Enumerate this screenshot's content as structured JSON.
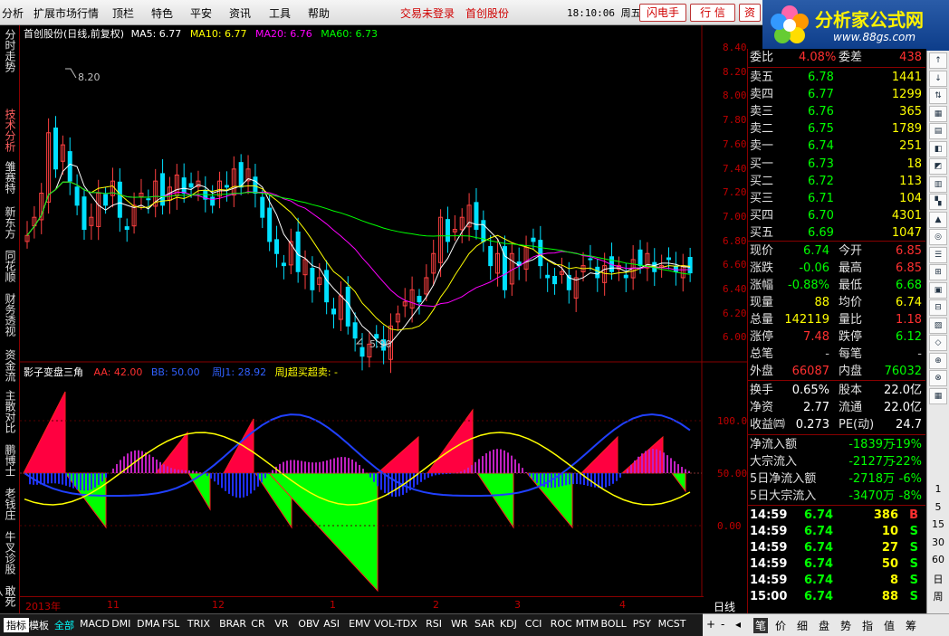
{
  "menu": [
    "分析",
    "扩展市场行情",
    "顶栏",
    "特色",
    "平安",
    "资讯",
    "工具",
    "帮助"
  ],
  "menu_status": [
    "交易未登录",
    "首创股份"
  ],
  "clock": "18:10:06 周五",
  "toolbar_buttons": [
    "闪电手",
    "行 信",
    "资"
  ],
  "logo": {
    "title": "分析家公式网",
    "url": "www.88gs.com"
  },
  "left_tabs": [
    "分时走势",
    "技术分析",
    "雏赛特",
    "新东方",
    "同花顺",
    "财务透视",
    "资金流",
    "主散对比",
    "鹏博士",
    "老钱庄",
    "牛叉诊股",
    "敢死队"
  ],
  "chart": {
    "title": "首创股份(日线,前复权)",
    "ma": [
      {
        "label": "MA5: 6.77",
        "color": "#ffffff"
      },
      {
        "label": "MA10: 6.77",
        "color": "#ffff00"
      },
      {
        "label": "MA20: 6.76",
        "color": "#ff00ff"
      },
      {
        "label": "MA60: 6.73",
        "color": "#00ff00"
      }
    ],
    "high_label": "8.20",
    "low_label": "5.90",
    "yticks": [
      "8.40",
      "8.20",
      "8.00",
      "7.80",
      "7.60",
      "7.40",
      "7.20",
      "7.00",
      "6.80",
      "6.60",
      "6.40",
      "6.20",
      "6.00"
    ]
  },
  "indicator": {
    "name": "影子变盘三角",
    "aa": "AA: 42.00",
    "bb": "BB: 50.00",
    "j": "周J1: 28.92",
    "signal": "周J超买超卖: -",
    "yticks": [
      "100.0",
      "50.00",
      "0.00"
    ]
  },
  "date_axis": [
    "2013年",
    "11",
    "12",
    "1",
    "2",
    "3",
    "4"
  ],
  "period": "日线",
  "quote": {
    "webi": {
      "label": "委比",
      "value": "4.08%",
      "label2": "委差",
      "value2": "438"
    },
    "sell": [
      {
        "label": "卖五",
        "price": "6.78",
        "vol": "1441"
      },
      {
        "label": "卖四",
        "price": "6.77",
        "vol": "1299"
      },
      {
        "label": "卖三",
        "price": "6.76",
        "vol": "365"
      },
      {
        "label": "卖二",
        "price": "6.75",
        "vol": "1789"
      },
      {
        "label": "卖一",
        "price": "6.74",
        "vol": "251"
      }
    ],
    "buy": [
      {
        "label": "买一",
        "price": "6.73",
        "vol": "18"
      },
      {
        "label": "买二",
        "price": "6.72",
        "vol": "113"
      },
      {
        "label": "买三",
        "price": "6.71",
        "vol": "104"
      },
      {
        "label": "买四",
        "price": "6.70",
        "vol": "4301"
      },
      {
        "label": "买五",
        "price": "6.69",
        "vol": "1047"
      }
    ],
    "stats": [
      {
        "l1": "现价",
        "v1": "6.74",
        "c1": "#00ff00",
        "l2": "今开",
        "v2": "6.85",
        "c2": "#ff3030"
      },
      {
        "l1": "涨跌",
        "v1": "-0.06",
        "c1": "#00ff00",
        "l2": "最高",
        "v2": "6.85",
        "c2": "#ff3030"
      },
      {
        "l1": "涨幅",
        "v1": "-0.88%",
        "c1": "#00ff00",
        "l2": "最低",
        "v2": "6.68",
        "c2": "#00ff00"
      },
      {
        "l1": "现量",
        "v1": "88",
        "c1": "#ffff00",
        "l2": "均价",
        "v2": "6.74",
        "c2": "#ffff00"
      },
      {
        "l1": "总量",
        "v1": "142119",
        "c1": "#ffff00",
        "l2": "量比",
        "v2": "1.18",
        "c2": "#ff3030"
      },
      {
        "l1": "涨停",
        "v1": "7.48",
        "c1": "#ff3030",
        "l2": "跌停",
        "v2": "6.12",
        "c2": "#00ff00"
      },
      {
        "l1": "总笔",
        "v1": "-",
        "c1": "#c0c0c0",
        "l2": "每笔",
        "v2": "-",
        "c2": "#c0c0c0"
      },
      {
        "l1": "外盘",
        "v1": "66087",
        "c1": "#ff3030",
        "l2": "内盘",
        "v2": "76032",
        "c2": "#00ff00"
      }
    ],
    "fin": [
      {
        "l1": "换手",
        "v1": "0.65%",
        "l2": "股本",
        "v2": "22.0亿"
      },
      {
        "l1": "净资",
        "v1": "2.77",
        "l2": "流通",
        "v2": "22.0亿"
      },
      {
        "l1": "收益㈣",
        "v1": "0.273",
        "l2": "PE(动)",
        "v2": "24.7"
      }
    ],
    "flows": [
      {
        "label": "净流入额",
        "value": "-1839万",
        "pct": "-19%"
      },
      {
        "label": "大宗流入",
        "value": "-2127万",
        "pct": "-22%"
      },
      {
        "label": "5日净流入额",
        "value": "-2718万",
        "pct": "-6%"
      },
      {
        "label": "5日大宗流入",
        "value": "-3470万",
        "pct": "-8%"
      }
    ],
    "ticks": [
      {
        "time": "14:59",
        "price": "6.74",
        "vol": "386",
        "flag": "B"
      },
      {
        "time": "14:59",
        "price": "6.74",
        "vol": "10",
        "flag": "S"
      },
      {
        "time": "14:59",
        "price": "6.74",
        "vol": "27",
        "flag": "S"
      },
      {
        "time": "14:59",
        "price": "6.74",
        "vol": "50",
        "flag": "S"
      },
      {
        "time": "14:59",
        "price": "6.74",
        "vol": "8",
        "flag": "S"
      },
      {
        "time": "15:00",
        "price": "6.74",
        "vol": "88",
        "flag": "S"
      }
    ]
  },
  "right_numbers": [
    "1",
    "5",
    "15",
    "30",
    "60",
    "日",
    "周"
  ],
  "bottom_tabs": [
    "指标",
    "模板",
    "全部",
    "MACD",
    "DMI",
    "DMA",
    "FSL",
    "TRIX",
    "BRAR",
    "CR",
    "VR",
    "OBV",
    "ASI",
    "EMV",
    "VOL-TDX",
    "RSI",
    "WR",
    "SAR",
    "KDJ",
    "CCI",
    "ROC",
    "MTM",
    "BOLL",
    "PSY",
    "MCST"
  ],
  "bottom_right": [
    "笔",
    "价",
    "细",
    "盘",
    "势",
    "指",
    "值",
    "筹"
  ]
}
